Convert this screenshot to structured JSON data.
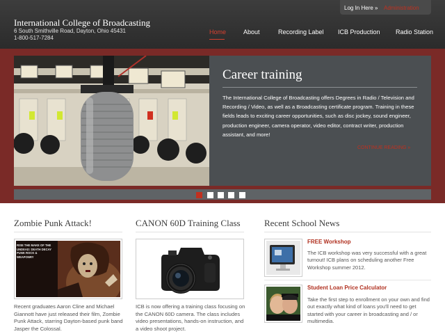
{
  "header": {
    "brand_name": "International College of Broadcasting",
    "address": "6 South Smithville Road, Dayton, Ohio 45431",
    "phone": "1-800-517-7284",
    "login_label": "Log In Here »",
    "admin_label": "Administration"
  },
  "nav": {
    "items": [
      {
        "label": "Home"
      },
      {
        "label": "About"
      },
      {
        "label": "Recording Label"
      },
      {
        "label": "ICB Production"
      },
      {
        "label": "Radio Station"
      }
    ]
  },
  "hero": {
    "title": "Career training",
    "body": "The International College of Broadcasting offers Degrees in Radio / Television and Recording / Video, as well as a Broadcasting certificate program. Training in these fields leads to exciting career opportunities, such as disc jockey, sound engineer, production engineer, camera operator, video editor, contract writer, production assistant, and more!",
    "more_label": "CONTINUE READING »",
    "slide_count": 5,
    "active_slide": 1
  },
  "columns": {
    "zombie": {
      "title": "Zombie Punk Attack!",
      "poster_text": "RISE THE MAKE OF THE UNDEAD: DEATH DECAY PUNK ROCK & WEAPONRY",
      "body": "Recent graduates Aaron Cline and Michael Giannott have just released their film, Zombie Punk Attack, starring Dayton-based punk band Jasper the Colossal."
    },
    "canon": {
      "title": "CANON 60D Training Class",
      "body": "ICB is now offering a training class focusing on the CANON 60D camera. The class includes video presentations, hands-on instruction, and a video shoot project."
    },
    "news": {
      "title": "Recent School News",
      "items": [
        {
          "title": "FREE Workshop",
          "body": "The ICB workshop was very successful with a great turnout! ICB plans on scheduling another Free Workshop summer 2012."
        },
        {
          "title": "Student Loan Price Calculator",
          "body": "Take the first step to enrollment on your own and find out exactly what kind of loans you'll need to get started with your career in broadcasting and / or multimedia."
        }
      ]
    }
  },
  "colors": {
    "accent_red": "#c0301f",
    "header_bg": "#333333",
    "hero_band": "#7a2a27",
    "hero_panel": "#4b4f52"
  }
}
